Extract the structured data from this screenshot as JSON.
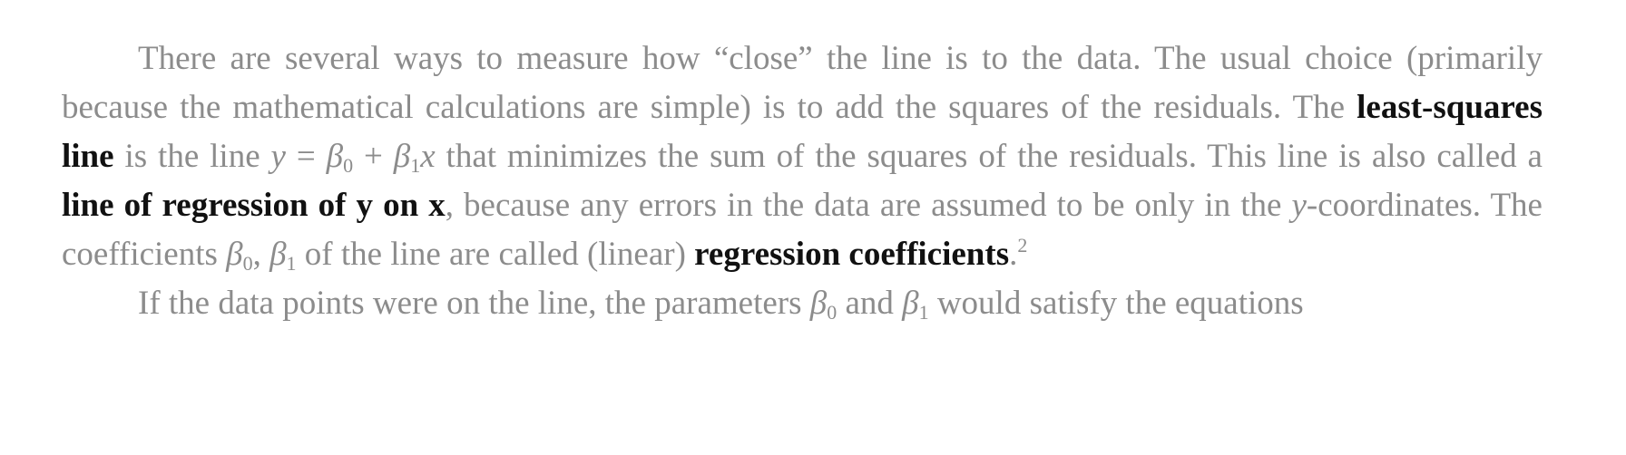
{
  "paragraph1": {
    "t1": "There are several ways to measure how “close” the line is to the data. The usual choice (primarily because the mathematical calculations are simple) is to add the squares of the residuals. The ",
    "b1": "least-squares line",
    "t2": " is the line ",
    "eq_y": "y",
    "eq_eq": " = ",
    "eq_b0": "β",
    "eq_b0_sub": "0",
    "eq_plus": " + ",
    "eq_b1": "β",
    "eq_b1_sub": "1",
    "eq_x": "x",
    "t3": " that minimizes the sum of the squares of the residuals. This line is also called a ",
    "b2": "line of regression of y on x",
    "t4": ", because any errors in the data are assumed to be only in the ",
    "t4_y": "y",
    "t5": "-coordinates. The coefficients ",
    "c_b0": "β",
    "c_b0_sub": "0",
    "c_sep": ", ",
    "c_b1": "β",
    "c_b1_sub": "1",
    "t6": " of the line are called (linear) ",
    "b3": "regression coefficients",
    "t7": ".",
    "footnote": "2"
  },
  "paragraph2": {
    "t1": "If the data points were on the line, the parameters ",
    "p_b0": "β",
    "p_b0_sub": "0",
    "t2": " and ",
    "p_b1": "β",
    "p_b1_sub": "1",
    "t3": " would satisfy the equations"
  }
}
